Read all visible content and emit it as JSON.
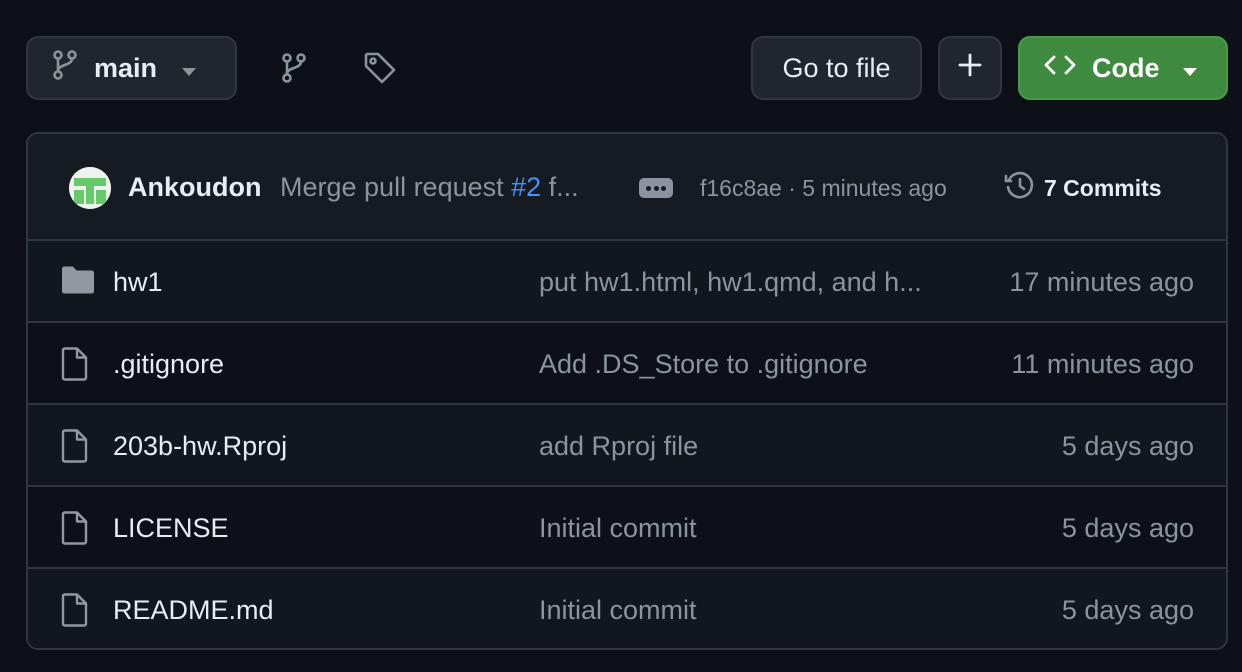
{
  "toolbar": {
    "branch": "main",
    "goto_label": "Go to file",
    "plus_label": "+",
    "code_label": "Code",
    "icons": {
      "branch": "git-branch-icon",
      "branches": "git-branch-icon",
      "tags": "tag-icon",
      "code": "code-icon",
      "caret": "triangle-down-icon"
    }
  },
  "commit": {
    "author": "Ankoudon",
    "message_prefix": "Merge pull request ",
    "pr_link": "#2",
    "message_suffix": " f...",
    "sha_time": "f16c8ae · 5 minutes ago",
    "history_label": "7 Commits"
  },
  "files": [
    {
      "type": "folder",
      "name": "hw1",
      "message": "put hw1.html, hw1.qmd, and h...",
      "time": "17 minutes ago"
    },
    {
      "type": "file",
      "name": ".gitignore",
      "message": "Add .DS_Store to .gitignore",
      "time": "11 minutes ago"
    },
    {
      "type": "file",
      "name": "203b-hw.Rproj",
      "message": "add Rproj file",
      "time": "5 days ago"
    },
    {
      "type": "file",
      "name": "LICENSE",
      "message": "Initial commit",
      "time": "5 days ago"
    },
    {
      "type": "file",
      "name": "README.md",
      "message": "Initial commit",
      "time": "5 days ago"
    }
  ],
  "colors": {
    "background": "#0d1117",
    "code_button": "#3e8b3f",
    "link": "#4493f8",
    "muted": "#8b949e"
  }
}
